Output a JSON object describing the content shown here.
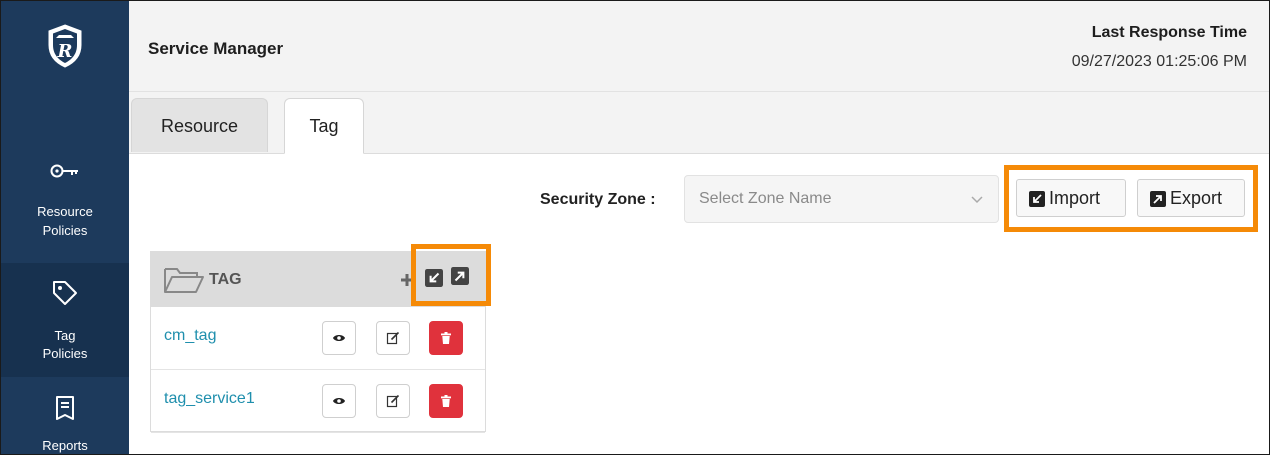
{
  "app": {
    "title": "Service Manager"
  },
  "header": {
    "last_response_label": "Last Response Time",
    "last_response_value": "09/27/2023 01:25:06 PM"
  },
  "sidebar": {
    "items": [
      {
        "label_line1": "Resource",
        "label_line2": "Policies",
        "icon": "key-icon",
        "active": false
      },
      {
        "label_line1": "Tag",
        "label_line2": "Policies",
        "icon": "tag-icon",
        "active": true
      },
      {
        "label_line1": "Reports",
        "label_line2": "",
        "icon": "report-icon",
        "active": false
      }
    ]
  },
  "tabs": [
    {
      "label": "Resource",
      "active": false
    },
    {
      "label": "Tag",
      "active": true
    }
  ],
  "zone": {
    "label": "Security Zone :",
    "placeholder": "Select Zone Name"
  },
  "actions": {
    "import_label": "Import",
    "export_label": "Export"
  },
  "tag_panel": {
    "title": "TAG",
    "services": [
      {
        "name": "cm_tag"
      },
      {
        "name": "tag_service1"
      }
    ]
  },
  "colors": {
    "sidebar": "#1d3a5c",
    "highlight": "#f58a07",
    "link": "#1f8fad",
    "delete": "#e0323c"
  }
}
